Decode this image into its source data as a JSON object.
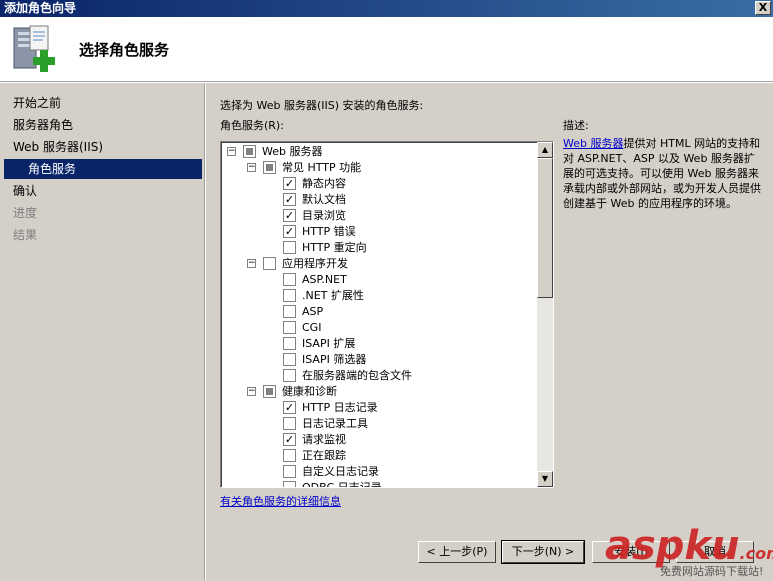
{
  "window": {
    "title": "添加角色向导",
    "close_label": "X"
  },
  "header": {
    "title": "选择角色服务",
    "icon": "server-add-icon"
  },
  "nav": {
    "items": [
      {
        "label": "开始之前",
        "state": "normal"
      },
      {
        "label": "服务器角色",
        "state": "normal"
      },
      {
        "label": "Web 服务器(IIS)",
        "state": "normal"
      },
      {
        "label": "角色服务",
        "state": "active"
      },
      {
        "label": "确认",
        "state": "normal"
      },
      {
        "label": "进度",
        "state": "disabled"
      },
      {
        "label": "结果",
        "state": "disabled"
      }
    ]
  },
  "main": {
    "instruction": "选择为 Web 服务器(IIS) 安装的角色服务:",
    "tree_label": "角色服务(R):",
    "tree": [
      {
        "label": "Web 服务器",
        "level": 0,
        "expander": "−",
        "check": "partial"
      },
      {
        "label": "常见 HTTP 功能",
        "level": 1,
        "expander": "−",
        "check": "partial"
      },
      {
        "label": "静态内容",
        "level": 2,
        "check": "checked"
      },
      {
        "label": "默认文档",
        "level": 2,
        "check": "checked"
      },
      {
        "label": "目录浏览",
        "level": 2,
        "check": "checked"
      },
      {
        "label": "HTTP 错误",
        "level": 2,
        "check": "checked"
      },
      {
        "label": "HTTP 重定向",
        "level": 2,
        "check": "unchecked"
      },
      {
        "label": "应用程序开发",
        "level": 1,
        "expander": "−",
        "check": "unchecked"
      },
      {
        "label": "ASP.NET",
        "level": 2,
        "check": "unchecked"
      },
      {
        "label": ".NET 扩展性",
        "level": 2,
        "check": "unchecked"
      },
      {
        "label": "ASP",
        "level": 2,
        "check": "unchecked"
      },
      {
        "label": "CGI",
        "level": 2,
        "check": "unchecked"
      },
      {
        "label": "ISAPI 扩展",
        "level": 2,
        "check": "unchecked"
      },
      {
        "label": "ISAPI 筛选器",
        "level": 2,
        "check": "unchecked"
      },
      {
        "label": "在服务器端的包含文件",
        "level": 2,
        "check": "unchecked"
      },
      {
        "label": "健康和诊断",
        "level": 1,
        "expander": "−",
        "check": "partial"
      },
      {
        "label": "HTTP 日志记录",
        "level": 2,
        "check": "checked"
      },
      {
        "label": "日志记录工具",
        "level": 2,
        "check": "unchecked"
      },
      {
        "label": "请求监视",
        "level": 2,
        "check": "checked"
      },
      {
        "label": "正在跟踪",
        "level": 2,
        "check": "unchecked"
      },
      {
        "label": "自定义日志记录",
        "level": 2,
        "check": "unchecked"
      },
      {
        "label": "ODBC 日志记录",
        "level": 2,
        "check": "unchecked"
      }
    ],
    "more_info_link": "有关角色服务的详细信息"
  },
  "description": {
    "label": "描述:",
    "link": "Web 服务器",
    "text": "提供对 HTML 网站的支持和对 ASP.NET、ASP 以及 Web 服务器扩展的可选支持。可以使用 Web 服务器来承载内部或外部网站，或为开发人员提供创建基于 Web 的应用程序的环境。"
  },
  "buttons": {
    "prev": "< 上一步(P)",
    "next": "下一步(N) >",
    "install": "安装(I)",
    "cancel": "取消"
  },
  "watermark": {
    "brand": "aspku",
    "suffix": ".com",
    "tagline": "免费网站源码下载站!"
  }
}
